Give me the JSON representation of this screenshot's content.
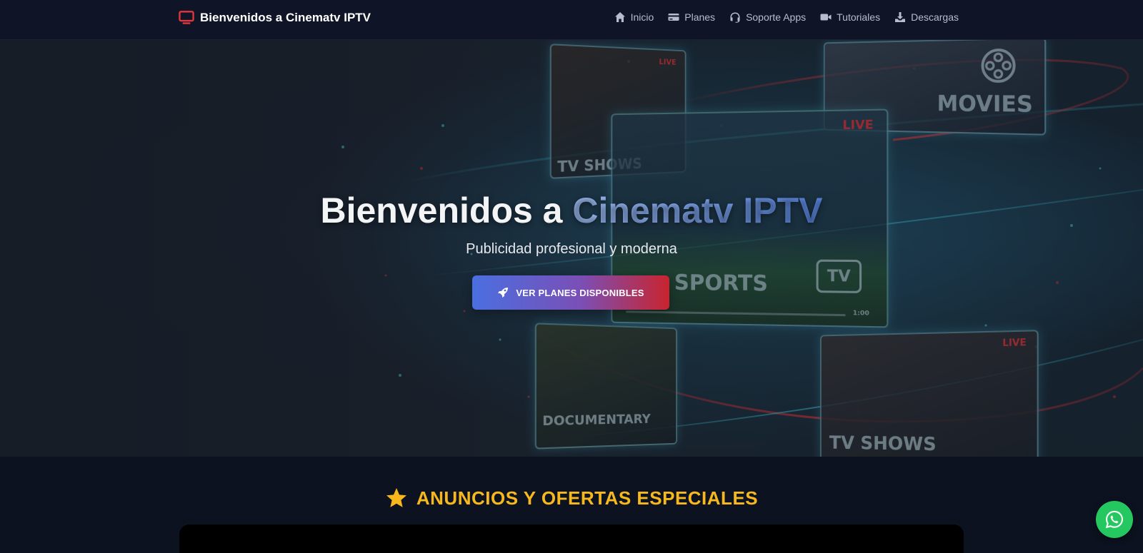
{
  "brand": {
    "title": "Bienvenidos a Cinematv IPTV",
    "accent_color": "#e0363d"
  },
  "nav": [
    {
      "label": "Inicio",
      "icon": "home-icon"
    },
    {
      "label": "Planes",
      "icon": "card-icon"
    },
    {
      "label": "Soporte Apps",
      "icon": "headset-icon"
    },
    {
      "label": "Tutoriales",
      "icon": "video-camera-icon"
    },
    {
      "label": "Descargas",
      "icon": "download-icon"
    }
  ],
  "hero": {
    "title_plain": "Bienvenidos a ",
    "title_accent": "Cinematv IPTV",
    "subtitle": "Publicidad profesional y moderna",
    "cta_label": "VER PLANES DISPONIBLES",
    "cta_icon": "rocket-icon",
    "art_labels": {
      "tv_shows_1": "TV SHOWS",
      "live_1": "LIVE",
      "movies": "MOVIES",
      "live_2": "LIVE",
      "sports": "SPORTS",
      "tv": "TV",
      "documentary": "DOCUMENTARY",
      "live_3": "LIVE",
      "tv_shows_2": "TV SHOWS",
      "time": "1:00"
    }
  },
  "offers": {
    "title": "ANUNCIOS Y OFERTAS ESPECIALES",
    "icon": "star-icon",
    "title_color": "#f6b81c"
  },
  "whatsapp": {
    "icon": "whatsapp-icon",
    "color": "#25c860"
  }
}
